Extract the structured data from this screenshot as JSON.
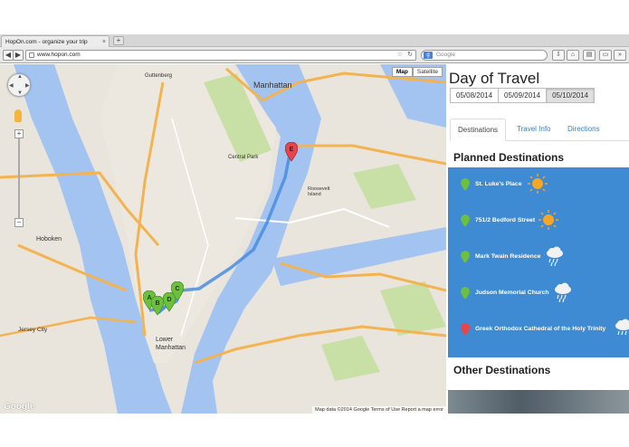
{
  "browser": {
    "tab_title": "HopOn.com - organize your trip",
    "url": "www.hopon.com",
    "search_placeholder": "Google"
  },
  "map": {
    "map_button": "Map",
    "satellite_button": "Satellite",
    "attribution": "Map data ©2014 Google   Terms of Use   Report a map error",
    "logo": "Google",
    "place_labels": [
      "Manhattan",
      "Hoboken",
      "Lower Manhattan",
      "Central Park",
      "Roosevelt Island",
      "Guttenberg",
      "Jersey City"
    ],
    "markers": [
      "A",
      "B",
      "D",
      "C",
      "E"
    ]
  },
  "sidebar": {
    "title": "Day of Travel",
    "dates": [
      "05/08/2014",
      "05/09/2014",
      "05/10/2014"
    ],
    "active_date": "05/10/2014",
    "tabs": [
      "Destinations",
      "Travel Info",
      "Directions"
    ],
    "active_tab": "Destinations",
    "planned_title": "Planned Destinations",
    "planned": [
      {
        "name": "St. Luke's Place",
        "pin": "green",
        "weather": "sun-icon"
      },
      {
        "name": "751/2 Bedford Street",
        "pin": "green",
        "weather": "sun-icon"
      },
      {
        "name": "Mark Twain Residence",
        "pin": "green",
        "weather": "rain-cloud-icon"
      },
      {
        "name": "Judson Memorial Church",
        "pin": "green",
        "weather": "rain-cloud-icon"
      },
      {
        "name": "Greek Orthodox Cathedral of the Holy Trinity",
        "pin": "red",
        "weather": "rain-cloud-icon"
      }
    ],
    "other_title": "Other Destinations"
  },
  "colors": {
    "accent": "#3f8bd3",
    "green_pin": "#6cbf3f",
    "red_pin": "#e8454b",
    "water": "#a3c4f1",
    "park": "#c8dfa6",
    "road": "#f4b351"
  }
}
